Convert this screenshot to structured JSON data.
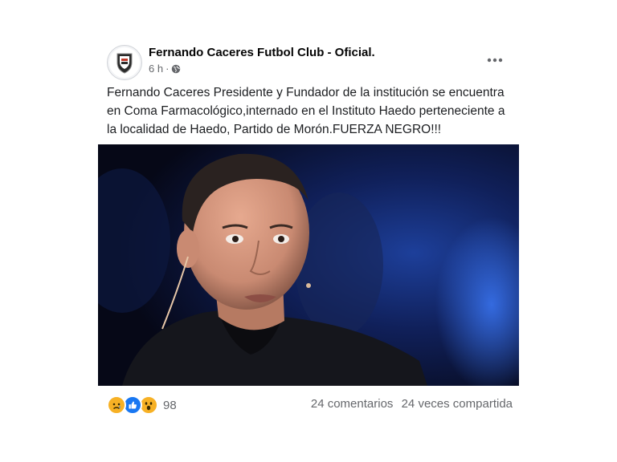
{
  "post": {
    "page_name": "Fernando Caceres Futbol Club - Oficial.",
    "time": "6 h",
    "separator": "·",
    "privacy_icon": "globe-icon",
    "more_icon": "ellipsis-icon",
    "text": "Fernando Caceres Presidente y Fundador de la institución se encuentra en Coma Farmacológico,internado en el Instituto Haedo perteneciente a la localidad de Haedo, Partido de Morón.FUERZA NEGRO!!!",
    "photo": "man-portrait-photo"
  },
  "footer": {
    "reactions": [
      "sad-reaction-icon",
      "like-reaction-icon",
      "wow-reaction-icon"
    ],
    "reaction_count": "98",
    "comments": "24 comentarios",
    "shares": "24 veces compartida"
  },
  "colors": {
    "text": "#050505",
    "secondary": "#65676b",
    "like_blue": "#1877f2",
    "reaction_yellow": "#f7b125"
  }
}
